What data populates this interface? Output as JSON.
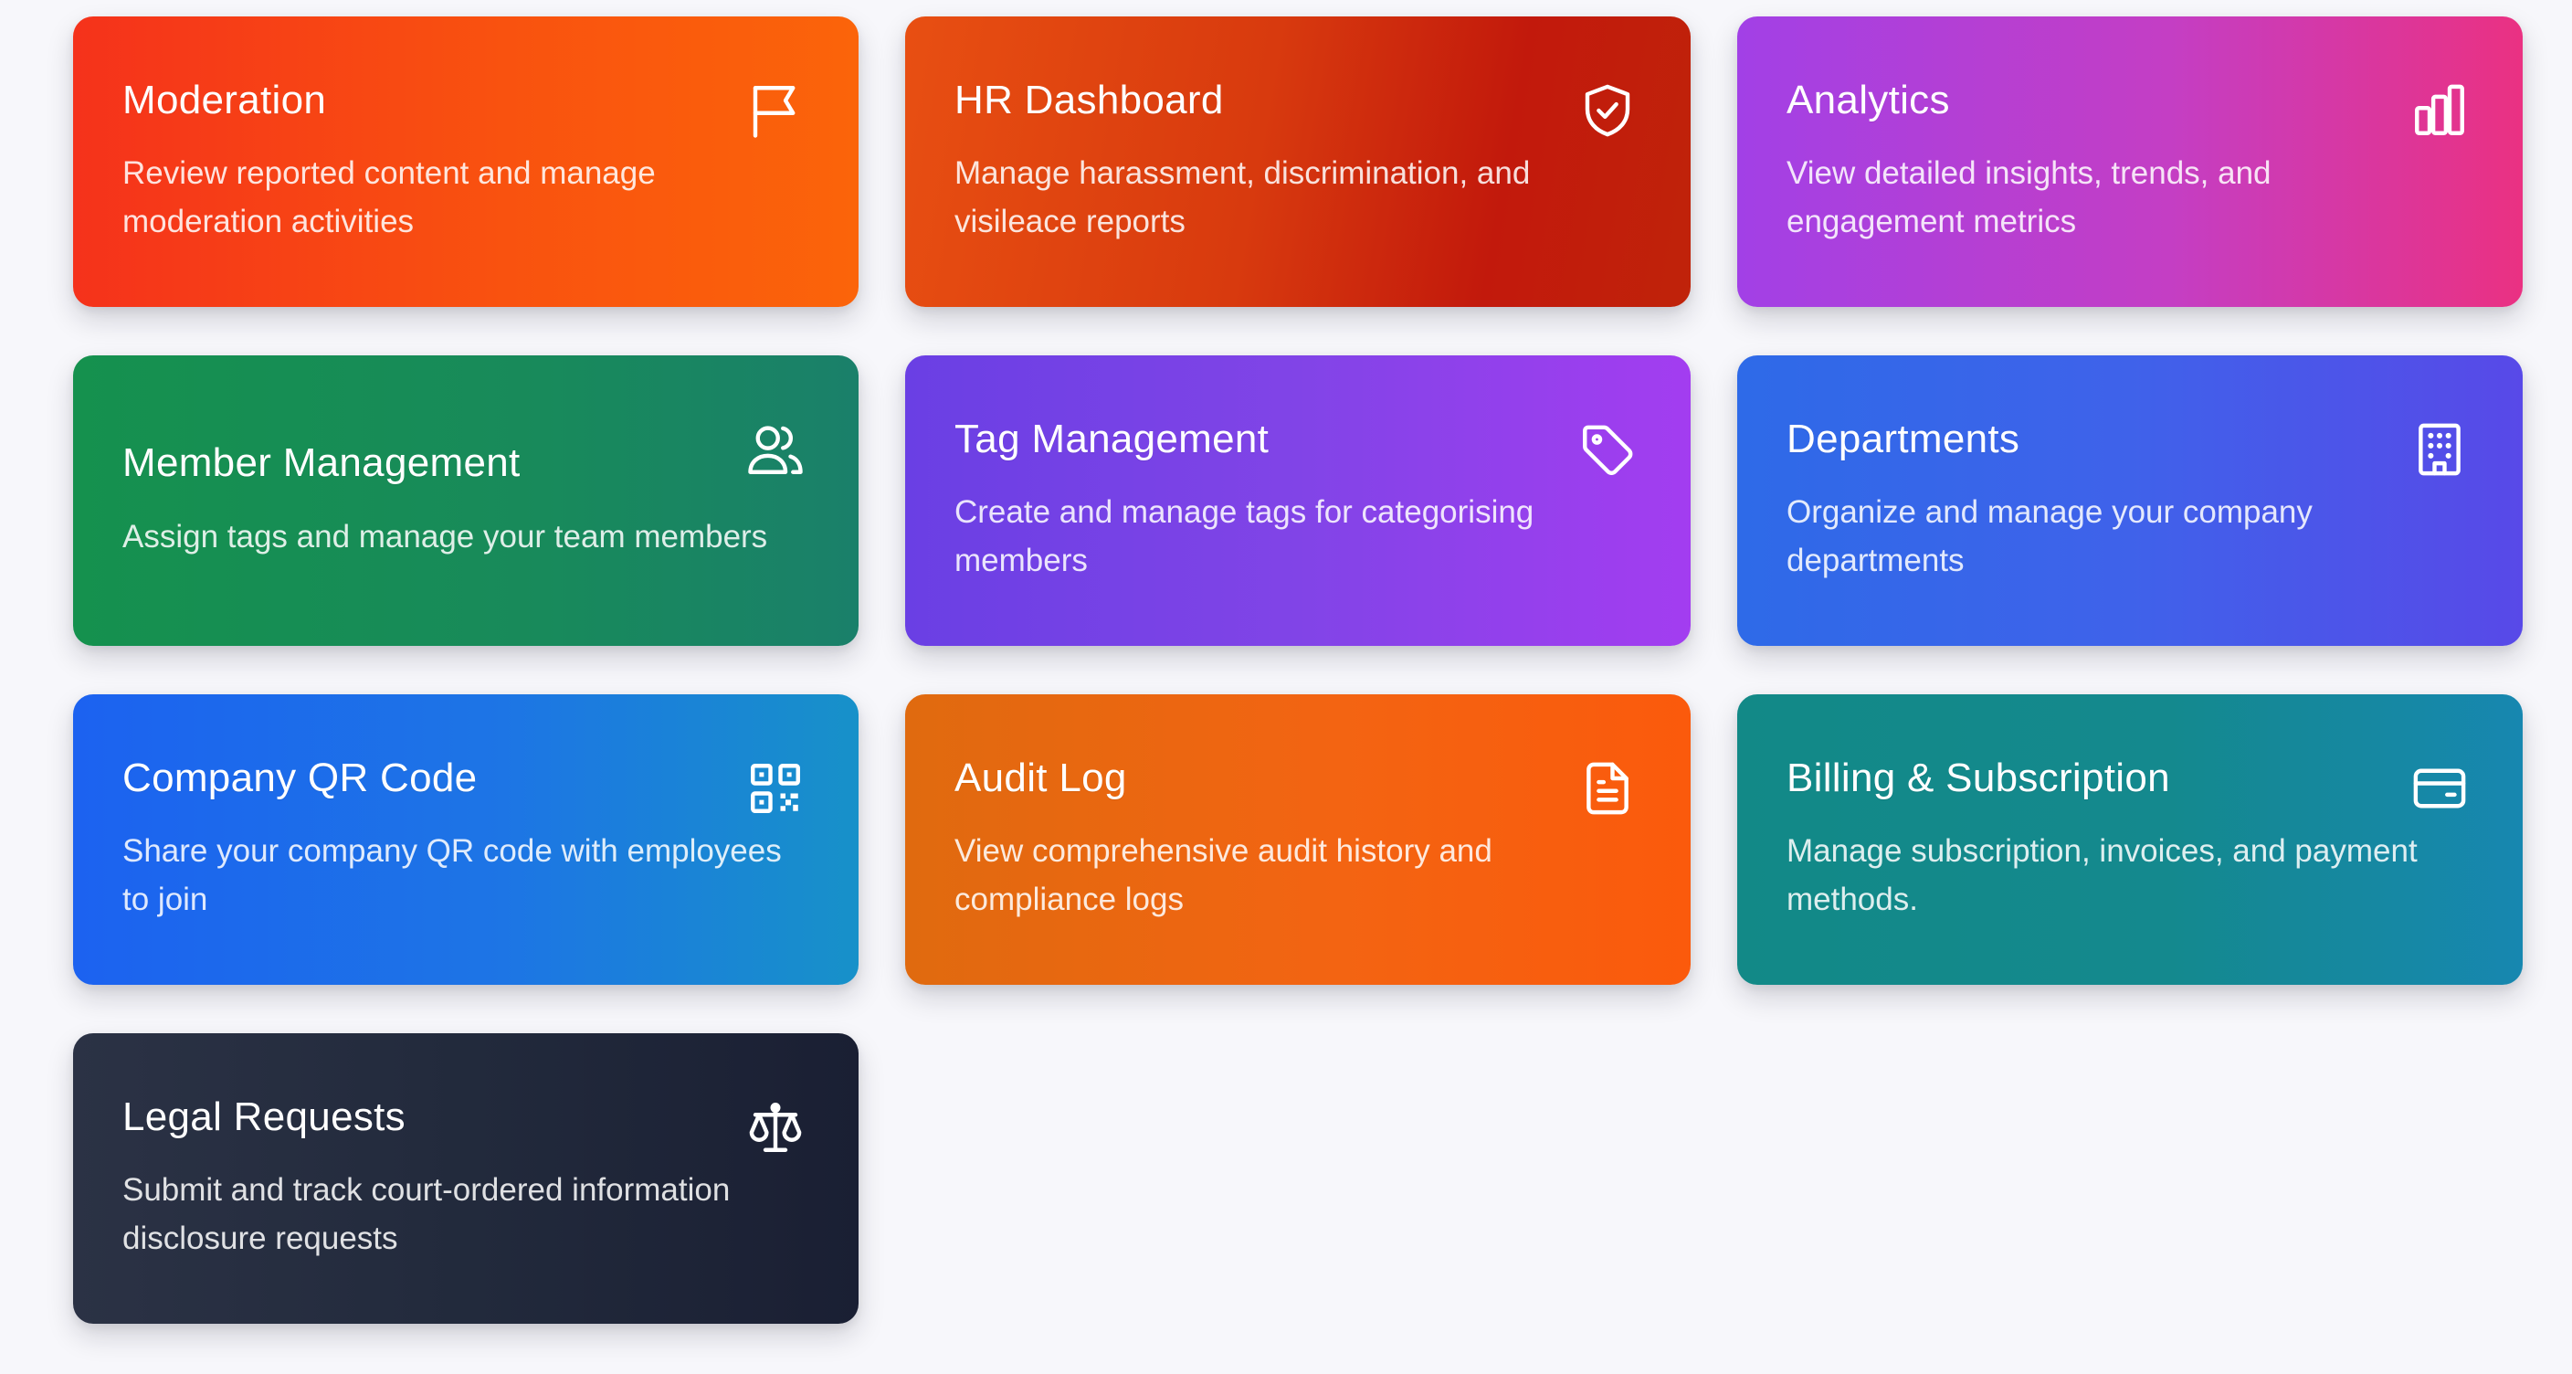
{
  "cards": [
    {
      "title": "Moderation",
      "description": "Review reported content and manage moderation activities",
      "icon": "flag-icon",
      "gradient": [
        "#f5321b",
        "#fb640a"
      ]
    },
    {
      "title": "HR Dashboard",
      "description": "Manage harassment, discrimination, and visileace reports",
      "icon": "shield-check-icon",
      "gradient": [
        "#e84f12",
        "#c0230a"
      ]
    },
    {
      "title": "Analytics",
      "description": "View detailed insights, trends, and engagement metrics",
      "icon": "bar-chart-icon",
      "gradient": [
        "#a240e6",
        "#ea3182"
      ]
    },
    {
      "title": "Member Management",
      "description": "Assign tags and manage your team members",
      "icon": "users-icon",
      "gradient": [
        "#15914e",
        "#1a806a"
      ]
    },
    {
      "title": "Tag Management",
      "description": "Create and manage tags for categorising members",
      "icon": "tag-icon",
      "gradient": [
        "#6a3fe4",
        "#a33df0"
      ]
    },
    {
      "title": "Departments",
      "description": "Organize and manage your company departments",
      "icon": "building-icon",
      "gradient": [
        "#2e6ae8",
        "#5849e8"
      ]
    },
    {
      "title": "Company QR Code",
      "description": "Share your company QR code with employees to join",
      "icon": "qr-code-icon",
      "gradient": [
        "#1c62f0",
        "#1791c9"
      ]
    },
    {
      "title": "Audit Log",
      "description": "View comprehensive audit history and compliance logs",
      "icon": "file-text-icon",
      "gradient": [
        "#e06a0f",
        "#fb5a0c"
      ]
    },
    {
      "title": "Billing & Subscription",
      "description": "Manage subscription, invoices, and payment methods.",
      "icon": "credit-card-icon",
      "gradient": [
        "#128987",
        "#1787b0"
      ]
    },
    {
      "title": "Legal Requests",
      "description": "Submit and track court-ordered information disclosure requests",
      "icon": "scale-icon",
      "gradient": [
        "#2b3245",
        "#1a1f33"
      ]
    }
  ]
}
